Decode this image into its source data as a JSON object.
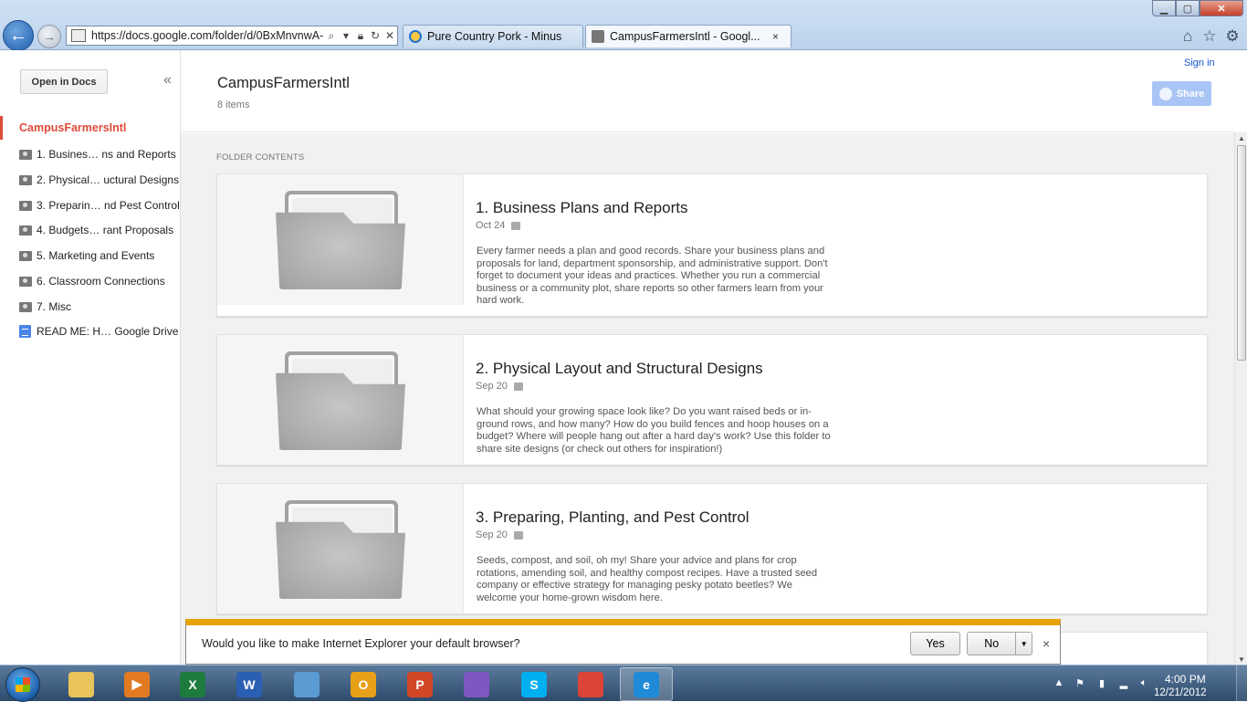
{
  "browser": {
    "address_url": "https://docs.google.com/folder/d/0BxMnvnwA-",
    "tabs": [
      {
        "label": "Pure Country Pork - Minus"
      },
      {
        "label": "CampusFarmersIntl - Googl..."
      }
    ],
    "tab_close": "×",
    "icons": [
      "back-arrow-icon",
      "forward-arrow-icon",
      "search-icon",
      "lock-icon",
      "refresh-icon",
      "stop-icon",
      "home-icon",
      "favorites-star-icon",
      "tools-gear-icon"
    ]
  },
  "sidebar": {
    "open_in_docs": "Open in Docs",
    "collapse_glyph": "«",
    "root_folder": "CampusFarmersIntl",
    "items": [
      {
        "label": "1. Busines… ns and Reports",
        "type": "shared-folder"
      },
      {
        "label": "2. Physical… uctural Designs",
        "type": "shared-folder"
      },
      {
        "label": "3. Preparin… nd Pest Control",
        "type": "shared-folder"
      },
      {
        "label": "4. Budgets…  rant Proposals",
        "type": "shared-folder"
      },
      {
        "label": "5. Marketing and Events",
        "type": "shared-folder"
      },
      {
        "label": "6. Classroom Connections",
        "type": "shared-folder"
      },
      {
        "label": "7. Misc",
        "type": "shared-folder"
      },
      {
        "label": "READ ME: H… Google Drive",
        "type": "document"
      }
    ]
  },
  "header": {
    "title": "CampusFarmersIntl",
    "item_count": "8 items",
    "sign_in": "Sign in",
    "share": "Share"
  },
  "content": {
    "section_label": "FOLDER CONTENTS",
    "cards": [
      {
        "title": "1. Business Plans and Reports",
        "date": "Oct 24",
        "description": "Every farmer needs a plan and good records. Share your business plans and proposals for land, department sponsorship, and administrative support. Don't forget to document your ideas and practices. Whether you run a commercial business or a community plot, share reports so other farmers learn from your hard work."
      },
      {
        "title": "2. Physical Layout and Structural Designs",
        "date": "Sep 20",
        "description": "What should your growing space look like? Do you want raised beds or in-ground rows, and how many? How do you build fences and hoop houses on a budget? Where will people hang out after a hard day's work? Use this folder to share site designs (or check out others for inspiration!)"
      },
      {
        "title": "3. Preparing, Planting, and Pest Control",
        "date": "Sep 20",
        "description": "Seeds, compost, and soil, oh my! Share your advice and plans for crop rotations, amending soil, and healthy compost recipes. Have a trusted seed company or effective strategy for managing pesky potato beetles? We welcome your home-grown wisdom here."
      }
    ]
  },
  "notification": {
    "message": "Would you like to make Internet Explorer your default browser?",
    "yes": "Yes",
    "no": "No",
    "dropdown_glyph": "▼",
    "close_glyph": "×"
  },
  "taskbar": {
    "apps": [
      {
        "name": "explorer-icon",
        "glyph": "",
        "color": "#e8c45a"
      },
      {
        "name": "media-player-icon",
        "glyph": "▶",
        "color": "#e27a22"
      },
      {
        "name": "excel-icon",
        "glyph": "X",
        "color": "#1e7b3e"
      },
      {
        "name": "word-icon",
        "glyph": "W",
        "color": "#2b5fb3"
      },
      {
        "name": "photo-viewer-icon",
        "glyph": "",
        "color": "#5a9bd4"
      },
      {
        "name": "outlook-icon",
        "glyph": "O",
        "color": "#e8a018"
      },
      {
        "name": "powerpoint-icon",
        "glyph": "P",
        "color": "#d24726"
      },
      {
        "name": "picasa-icon",
        "glyph": "",
        "color": "#7e57c2"
      },
      {
        "name": "skype-icon",
        "glyph": "S",
        "color": "#00aff0"
      },
      {
        "name": "chrome-icon",
        "glyph": "",
        "color": "#db4437"
      },
      {
        "name": "internet-explorer-icon",
        "glyph": "e",
        "color": "#1f8ad8"
      }
    ],
    "clock_time": "4:00 PM",
    "clock_date": "12/21/2012"
  }
}
